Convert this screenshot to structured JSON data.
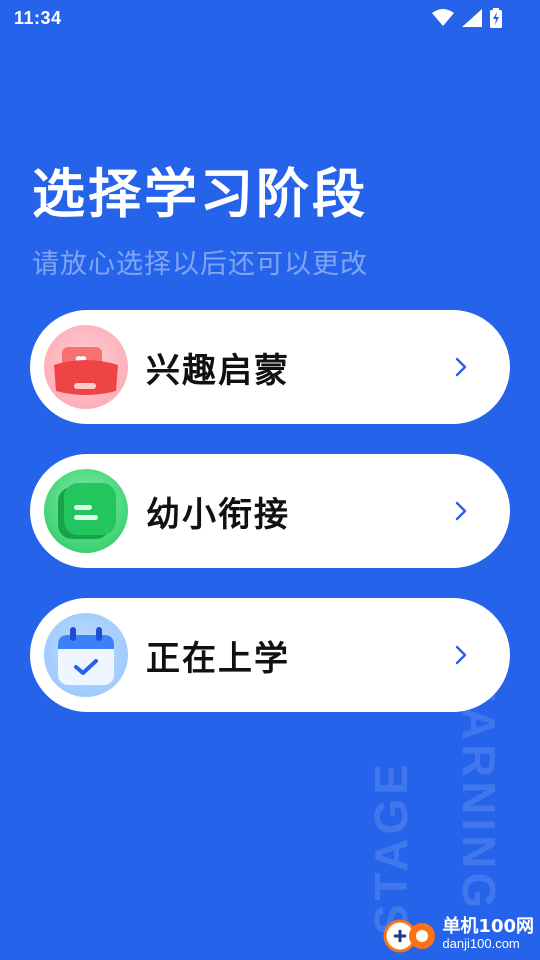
{
  "status_bar": {
    "time": "11:34",
    "icons": [
      "wifi-icon",
      "cell-signal-icon",
      "battery-charging-icon"
    ]
  },
  "header": {
    "title": "选择学习阶段",
    "subtitle": "请放心选择以后还可以更改"
  },
  "stages": [
    {
      "label": "兴趣启蒙",
      "icon": "heart-pouch-icon",
      "color": "#fb7185"
    },
    {
      "label": "幼小衔接",
      "icon": "green-note-icon",
      "color": "#22c55e"
    },
    {
      "label": "正在上学",
      "icon": "calendar-check-icon",
      "color": "#60a5fa"
    }
  ],
  "background_text": {
    "line1": "STAGE",
    "line2": "LEARNING"
  },
  "watermark": {
    "name": "单机100网",
    "url": "danji100.com"
  },
  "colors": {
    "background": "#2563eb",
    "card": "#ffffff",
    "arrow": "#2563eb"
  }
}
